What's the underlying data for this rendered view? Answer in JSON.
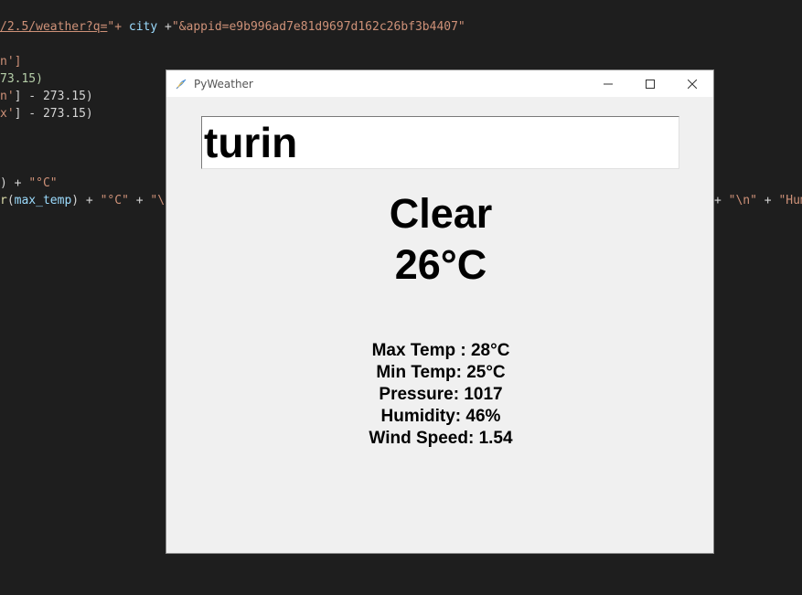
{
  "editor": {
    "line1": {
      "url": "/2.5/weather?q=",
      "mid": "\"+ ",
      "city_var": "city",
      "plus": " +",
      "appid": "\"&appid=e9b996ad7e81d9697d162c26bf3b4407\""
    },
    "line2": "n']",
    "line3": "73.15)",
    "line4": {
      "key": "n'",
      "rest": "] - 273.15)"
    },
    "line5": {
      "key": "x'",
      "rest": "] - 273.15)"
    },
    "line6": {
      "a": ") + ",
      "b": "\"°C\""
    },
    "line7": {
      "fn": "r",
      "paren": "(",
      "var": "max_temp",
      "close": ") + ",
      "deg": "\"°C\"",
      "plus": " + ",
      "nl": "\"\\n"
    },
    "line7_right": {
      "plus": "+ ",
      "nl": "\"\\n\"",
      "plus2": " + ",
      "hum": "\"Hum"
    }
  },
  "window": {
    "title": "PyWeather",
    "icons": {
      "app": "feather-icon",
      "minimize": "minimize-icon",
      "maximize": "maximize-icon",
      "close": "close-icon"
    }
  },
  "search": {
    "value": "turin"
  },
  "weather": {
    "condition": "Clear",
    "temperature": "26°C",
    "details": [
      "Max Temp : 28°C",
      "Min Temp: 25°C",
      "Pressure: 1017",
      "Humidity: 46%",
      "Wind Speed: 1.54"
    ]
  }
}
